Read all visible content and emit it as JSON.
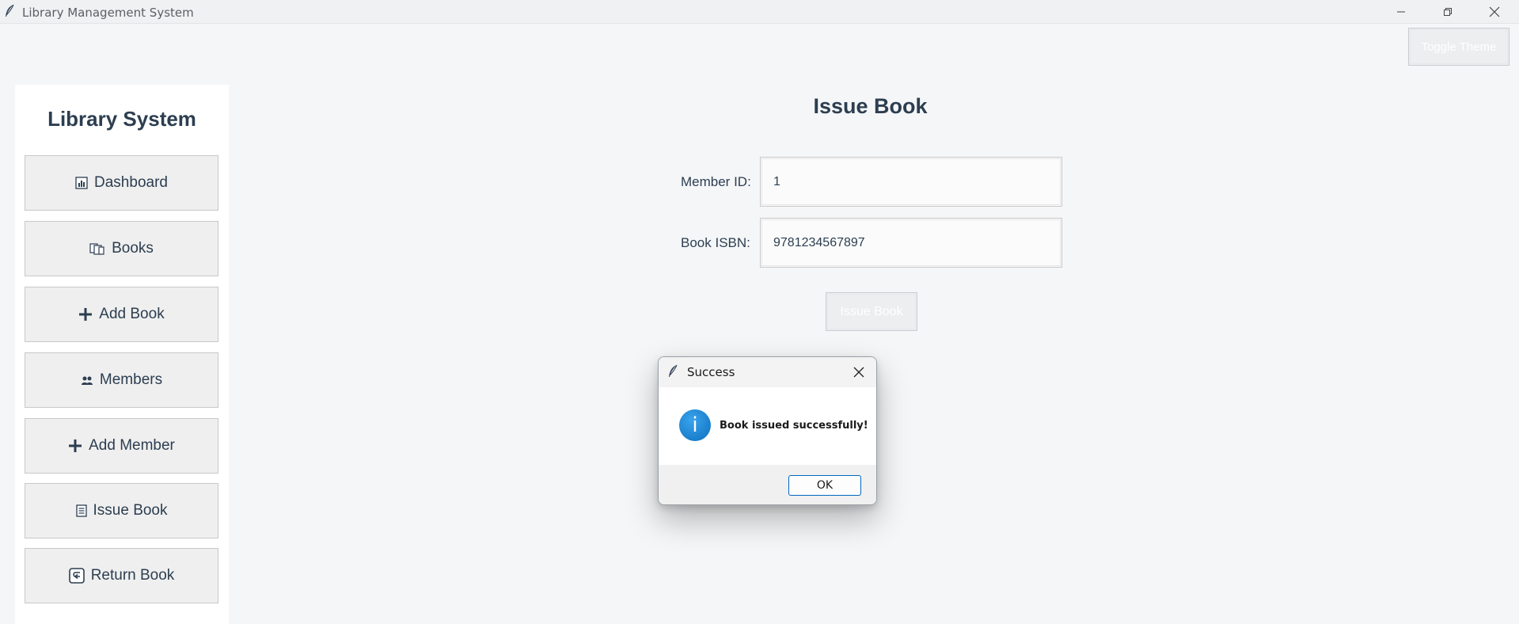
{
  "window": {
    "title": "Library Management System",
    "icon": "feather-icon"
  },
  "toolbar": {
    "toggle_theme_label": "Toggle Theme"
  },
  "sidebar": {
    "title": "Library System",
    "items": [
      {
        "label": "Dashboard",
        "icon": "chart-icon"
      },
      {
        "label": "Books",
        "icon": "books-icon"
      },
      {
        "label": "Add Book",
        "icon": "plus-icon"
      },
      {
        "label": "Members",
        "icon": "people-icon"
      },
      {
        "label": "Add Member",
        "icon": "plus-icon"
      },
      {
        "label": "Issue Book",
        "icon": "clipboard-icon"
      },
      {
        "label": "Return Book",
        "icon": "return-icon"
      }
    ]
  },
  "main": {
    "title": "Issue Book",
    "member_id_label": "Member ID:",
    "member_id_value": "1",
    "isbn_label": "Book ISBN:",
    "isbn_value": "9781234567897",
    "issue_button_label": "Issue Book"
  },
  "dialog": {
    "title": "Success",
    "message": "Book issued successfully!",
    "ok_label": "OK",
    "icon": "info-icon",
    "info_glyph": "i"
  },
  "colors": {
    "text": "#2c3e50",
    "info_blue": "#1a7fd4",
    "ok_border": "#0067c0"
  }
}
